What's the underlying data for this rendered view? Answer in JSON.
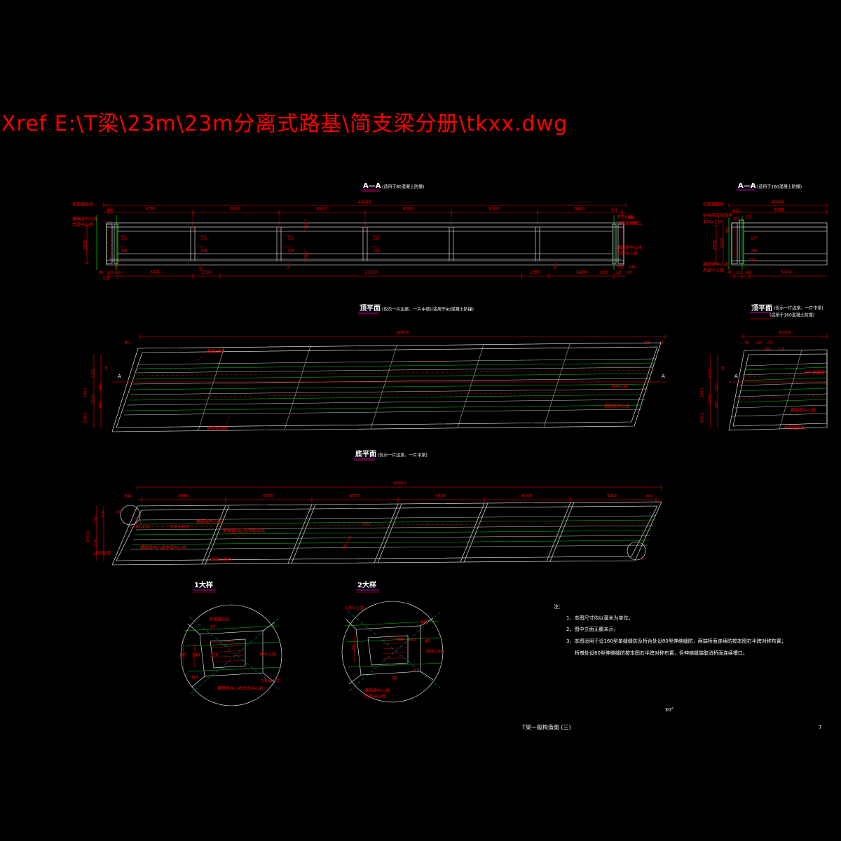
{
  "header": {
    "xref_line": "Xref E:\\T梁\\23m\\23m分离式路基\\简支梁分册\\tkxx.dwg"
  },
  "views": {
    "aa_left": {
      "title": "A—A",
      "note": "(适用于80混凝土防撞)"
    },
    "aa_right": {
      "title": "A—A",
      "note": "(适用于160混凝土防撞)"
    },
    "top_plan_left": {
      "title": "顶平面",
      "note": "(仅示一片边梁、一片中梁)(适用于80混凝土防撞)"
    },
    "top_plan_right": {
      "title": "顶平面",
      "note1": "(仅示一片边梁、一片中梁)",
      "note2": "(适用于160混凝土防撞)"
    },
    "bottom_plan": {
      "title": "底平面",
      "note": "(仅示一片边梁、一片中梁)"
    },
    "detail1": {
      "title": "1大样"
    },
    "detail2": {
      "title": "2大样"
    }
  },
  "elevation_left": {
    "overall": "40000",
    "top_chain": [
      "6360",
      "6500",
      "6500",
      "6500",
      "6500",
      "6400"
    ],
    "bottom_chain": [
      "5400",
      "2300",
      "21400",
      "2300",
      "5400"
    ],
    "left_small": [
      "80",
      "320",
      "360"
    ],
    "right_small": [
      "1000",
      "320",
      "240"
    ],
    "end_top": [
      "840",
      "600"
    ],
    "end_top2": "600",
    "height": "2500",
    "web_marks": [
      "231",
      "208",
      "231",
      "208",
      "231",
      "208"
    ],
    "small_v": [
      "350",
      "350",
      "350",
      "151"
    ],
    "labels": {
      "deck_line": "桥面铺装线",
      "bearing_center": "横隔梁中心线",
      "support_center": "支座中心线",
      "beam_center": "梁中心线",
      "expansion_joint": "桥面连接缝口"
    }
  },
  "elevation_right": {
    "overall": "40000",
    "seg": "6360",
    "guard": "404×220",
    "end_top": [
      "840",
      "400",
      "271",
      "271"
    ],
    "inner": [
      "227",
      "206",
      "158"
    ],
    "height_out": "2500",
    "height_in": "2600",
    "bottom": [
      "80",
      "320",
      "360",
      "5400"
    ],
    "labels": {
      "deck_line": "桥面铺装线",
      "guard_label": "护栏底座预埋件",
      "bearing_center": "横隔梁中心线",
      "support_center": "支座中心线"
    }
  },
  "top_plan_left": {
    "overall": "40000",
    "end_left": "80",
    "end_right": [
      "200",
      "40"
    ],
    "vert_left": [
      "1125",
      "2250",
      "400",
      "400",
      "40",
      "500/2",
      "500/2"
    ],
    "section_mark": "A",
    "labels": {
      "deck_line": "桥面铺装",
      "beam_center": "梁中心线",
      "bearing_center": "横隔梁中心线",
      "mid_line": "中梁轮廓线"
    }
  },
  "top_plan_right": {
    "overall": "40000",
    "dims": [
      "80",
      "220",
      "271",
      "100",
      "116"
    ],
    "vert_left": [
      "1125",
      "2250",
      "400",
      "400",
      "40",
      "500/2",
      "500/2"
    ],
    "section_mark": "A",
    "labels": {
      "guard_anchor": "护栏预埋件",
      "bearing_center": "横隔梁中心线",
      "mid_line": "中梁轮廓线"
    }
  },
  "bottom_plan": {
    "overall": "40000",
    "top_chain": [
      "6360",
      "6500",
      "6500",
      "6500",
      "6500",
      "6400"
    ],
    "end_left": "840",
    "end_right": "800",
    "detail_dims": [
      "100×100",
      "100×100",
      "100×100"
    ],
    "vert_left": [
      "2250",
      "1125",
      "2250/2",
      "500"
    ],
    "angle_label": "20°",
    "detail_call": [
      "1",
      "2"
    ],
    "labels": {
      "bearing_center": "横隔梁中心线",
      "support_center": "横隔梁中心线支座中心线",
      "mid_line": "中梁轮廓线",
      "edge_line": "边梁轮廓",
      "notch": "梁端锚固区齿块轮廓线"
    }
  },
  "detail1": {
    "dims": [
      "67",
      "80",
      "240",
      "320",
      "413",
      "100×100"
    ],
    "labels": {
      "beam_center": "梁中心线",
      "support": "横隔梁中心线支座中心线",
      "anchor": "梁端锚固区"
    }
  },
  "detail2": {
    "dims": [
      "100×100",
      "413",
      "380",
      "240",
      "46",
      "67",
      "80"
    ],
    "labels": {
      "beam_center": "梁中心线",
      "bearing_center": "横隔梁中心线",
      "support_center": "支座中心线"
    }
  },
  "notes": {
    "heading": "注：",
    "items": [
      "1、本图尺寸均以毫米为单位。",
      "2、图中立面无腹未示。",
      "3、本图适用于设160型单缝缝防及桥台处设80型伸缩缝防，两端桥面连续防按本图右半跨对称布置；",
      "桥墩处设80型伸缩缝防按本图右半跨对称布置，但伸缩缝端取消桥面连续槽口。"
    ]
  },
  "titleblock": {
    "angle": "30°",
    "title": "T梁一般构造图 (三)",
    "sheet": "7"
  },
  "colors": {
    "background": "#000000",
    "dimension": "#ff0000",
    "geometry": "#ffffff",
    "centerline": "#00ff00",
    "title_underline": "#ff00ff",
    "axis": "#00ffff"
  }
}
